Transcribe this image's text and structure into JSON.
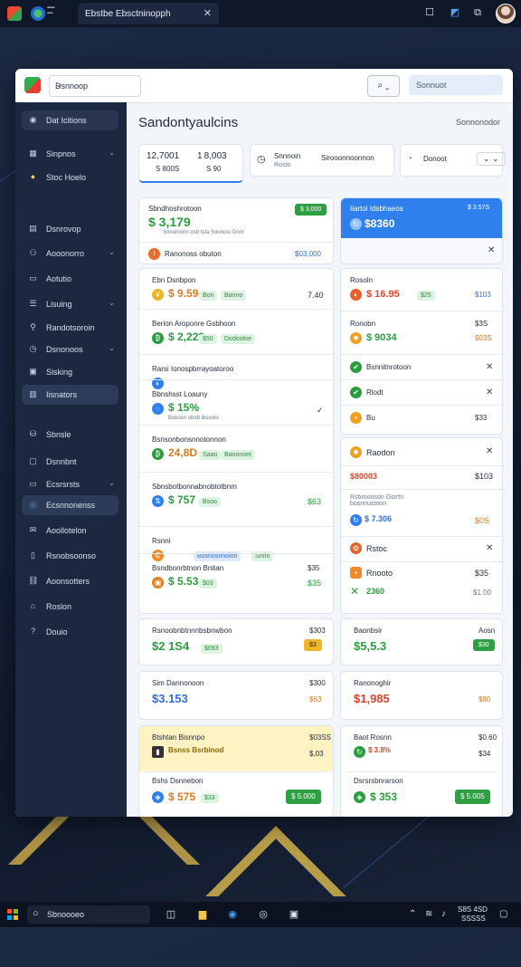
{
  "browser": {
    "tab_title": "Ebstbe Ebsctninopph",
    "close_glyph": "✕"
  },
  "header": {
    "account_select": "Dsnnoop",
    "search_placeholder": "Sonnuot",
    "search_glyph": "⌕ ⌄"
  },
  "sidebar": {
    "top_item": "Dat Icitions",
    "items": [
      {
        "label": "Sinpnos",
        "icon": "grid-icon",
        "chev": true
      },
      {
        "label": "Stoc Hoelo",
        "icon": "circle-icon",
        "chev": false
      },
      {
        "label": "Dsnrovop",
        "icon": "dashboard-icon",
        "chev": false
      },
      {
        "label": "Aooonorro",
        "icon": "people-icon",
        "chev": true
      },
      {
        "label": "Aotutio",
        "icon": "folder-icon",
        "chev": false
      },
      {
        "label": "Lisuing",
        "icon": "list-icon",
        "chev": true
      },
      {
        "label": "Randotsoroin",
        "icon": "user-icon",
        "chev": false
      },
      {
        "label": "Dsnonoos",
        "icon": "clock-icon",
        "chev": true
      },
      {
        "label": "Sisking",
        "icon": "box-icon",
        "chev": false
      },
      {
        "label": "Iisnators",
        "icon": "chart-icon",
        "chev": false
      },
      {
        "label": "Sbnsle",
        "icon": "db-icon",
        "chev": false
      },
      {
        "label": "Dsnnbnt",
        "icon": "doc-icon",
        "chev": false
      },
      {
        "label": "Ecsrsrsts",
        "icon": "card-icon",
        "chev": true
      },
      {
        "label": "Ecsnnonenss",
        "icon": "target-icon",
        "chev": false
      },
      {
        "label": "Aoollotelon",
        "icon": "mail-icon",
        "chev": false
      },
      {
        "label": "Rsnobsoonso",
        "icon": "file-icon",
        "chev": false
      },
      {
        "label": "Aoonsotters",
        "icon": "link-icon",
        "chev": false
      },
      {
        "label": "Roslon",
        "icon": "tag-icon",
        "chev": false
      },
      {
        "label": "Douio",
        "icon": "help-icon",
        "chev": false
      }
    ]
  },
  "main": {
    "title": "Sandontyaulcins",
    "header_right": "Sonnonodor",
    "stats": {
      "a_value": "12,7001",
      "a_sub": "S 800S",
      "b_value": "1 8,003",
      "b_sub": "S 90",
      "filter_label": "Snnnoin",
      "filter_sub": "Rosto",
      "filter_right": "Sirooonnoonnon",
      "dropdown_label": "Donoot"
    },
    "card_balance": {
      "title": "Sbndhoshrotoon",
      "value": "$ 3,179",
      "sub": "Snnoinonn osb tsta Soonoio Gnnl",
      "badge": "$ 3,000",
      "footer": "Ranonoss obuton",
      "footer_value": "$03,000"
    },
    "card_blue": {
      "title": "Iiartol Idsbhaeos",
      "right": "$ 3.57S",
      "value": "$8360",
      "close": "✕"
    },
    "left_list": [
      {
        "title": "Ebn Dsnbpon",
        "value": "$ 9.59",
        "pill1": "Bon",
        "pill2": "Banno",
        "right": "7.40"
      },
      {
        "title": "Berion Aroponre Gsbhoon",
        "value": "$ 2,223",
        "pill1": "$50",
        "pill2": "Dodostoe"
      },
      {
        "title": "Rarsi Ionospbrrayoatoroo",
        "value": ""
      },
      {
        "title": "Bbnshsst Loauny",
        "value": "$ 15%",
        "sub": "Bsbosn obob ibsoolo"
      },
      {
        "title": "Bsnsonbonsnnotonnon",
        "value": "24,8D",
        "pill1": "Saao",
        "pill2": "Banonoet"
      },
      {
        "title": "Sbnsbotbonnabnobtotbnm",
        "value": "$ 757",
        "pill1": "Bsoo",
        "right": "$63"
      },
      {
        "title": "Rsnni",
        "pill1": "Bosnosnnoion",
        "pill2": "Snrio"
      },
      {
        "title": "Bsndbonrbtnon Bnitan",
        "value": "$ 5.53",
        "pill1": "$03",
        "right_top": "$35",
        "right": "$35"
      }
    ],
    "right_list": [
      {
        "title": "Rosoln",
        "value": "$ 16.95",
        "pill1": "$25",
        "right": "$103"
      },
      {
        "title": "Ronobn",
        "value": "$ 9034",
        "right_top": "$3S",
        "right": "$03S"
      },
      {
        "title": "Bsnnitnrotoon",
        "close": "✕"
      },
      {
        "title": "Rlodt",
        "close": "✕"
      },
      {
        "title": "Bu",
        "right": "$33"
      }
    ],
    "right_card2": {
      "title": "Raodon",
      "close": "✕",
      "row1": "$80003",
      "row1_right": "$103",
      "sub": "Rsbroooson Gsrrtn bosnnusoton",
      "value": "$ 7.306",
      "value_right": "$0S",
      "row3": "Rstoc",
      "row3_close": "✕",
      "row4": "Rnooto",
      "row4_right": "$35",
      "value2": "2360",
      "value2_right": "$1.00"
    },
    "bottom_cards": [
      {
        "title": "Rsnoobnbtnnnbsbnwbon",
        "right": "$303",
        "value": "$2 1S4",
        "pill": "$093",
        "badge": "$3"
      },
      {
        "title": "Baonbsir",
        "right": "Aosn",
        "value": "$5,5.3",
        "badge": "$30"
      },
      {
        "title": "Sim Dannonoon",
        "right": "$300",
        "value": "$3.153",
        "right2": "$63"
      },
      {
        "title": "Ranonoghir",
        "value": "$1,985",
        "right2": "$80"
      },
      {
        "title": "Btshtan Bisnnpo",
        "right": "$03SS",
        "sub": "Bsnss Bsrbinod",
        "right2": "$,03",
        "row": "Bshs Dsnnebon",
        "value": "$ 575",
        "pill": "$33",
        "btn": "$ 5.000"
      },
      {
        "title": "Baot Rosnn",
        "right": "$0.60",
        "sub": "$ 3.8%",
        "right2": "$34",
        "row": "Dsrsrsbnrarson",
        "value": "$ 353",
        "btn": "$ 5.005"
      }
    ]
  },
  "taskbar": {
    "search": "Sbnoooeo",
    "time": "S8S 4SD",
    "date": "SSSSS"
  }
}
